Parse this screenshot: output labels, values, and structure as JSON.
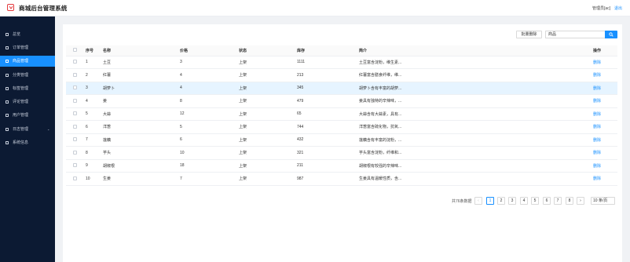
{
  "header": {
    "title": "商城后台管理系统",
    "user": "管理员[ac]",
    "logout": "退出"
  },
  "sidebar": {
    "items": [
      {
        "label": "总览"
      },
      {
        "label": "订单管理"
      },
      {
        "label": "商品管理"
      },
      {
        "label": "分类管理"
      },
      {
        "label": "标签管理"
      },
      {
        "label": "评论管理"
      },
      {
        "label": "用户管理"
      },
      {
        "label": "日志管理"
      },
      {
        "label": "系统信息"
      }
    ]
  },
  "toolbar": {
    "batch_delete": "批量删除",
    "search_value": "商品"
  },
  "table": {
    "headers": [
      "序号",
      "名称",
      "价格",
      "状态",
      "库存",
      "简介",
      "操作"
    ],
    "rows": [
      [
        "1",
        "土豆",
        "3",
        "上架",
        "1111",
        "土豆富含淀粉，维生素...",
        "删除"
      ],
      [
        "2",
        "红薯",
        "4",
        "上架",
        "213",
        "红薯富含膳食纤维，维...",
        "删除"
      ],
      [
        "3",
        "胡萝卜",
        "4",
        "上架",
        "345",
        "胡萝卜含有丰富的胡萝...",
        "删除"
      ],
      [
        "4",
        "姜",
        "8",
        "上架",
        "479",
        "姜具有独特的辛辣味，...",
        "删除"
      ],
      [
        "5",
        "大蒜",
        "12",
        "上架",
        "65",
        "大蒜含有大蒜素，具有...",
        "删除"
      ],
      [
        "6",
        "洋葱",
        "5",
        "上架",
        "744",
        "洋葱富含硫化物，抗氧...",
        "删除"
      ],
      [
        "7",
        "莲藕",
        "6",
        "上架",
        "432",
        "莲藕含有丰富的淀粉，...",
        "删除"
      ],
      [
        "8",
        "芋头",
        "10",
        "上架",
        "321",
        "芋头富含淀粉，纤维和...",
        "删除"
      ],
      [
        "9",
        "胡椒根",
        "18",
        "上架",
        "211",
        "胡椒根有较强的辛辣味...",
        "删除"
      ],
      [
        "10",
        "生姜",
        "7",
        "上架",
        "987",
        "生姜具有温暖性质，含...",
        "删除"
      ]
    ]
  },
  "pagination": {
    "total": "共76条数据",
    "prev": "‹",
    "pages": [
      "1",
      "2",
      "3",
      "4",
      "5",
      "6",
      "7",
      "8"
    ],
    "next": "›",
    "page_size": "10 条/页"
  },
  "colors": {
    "sidebar": "#0c1a33",
    "accent": "#1890ff",
    "highlight_row": "#e6f4ff"
  }
}
